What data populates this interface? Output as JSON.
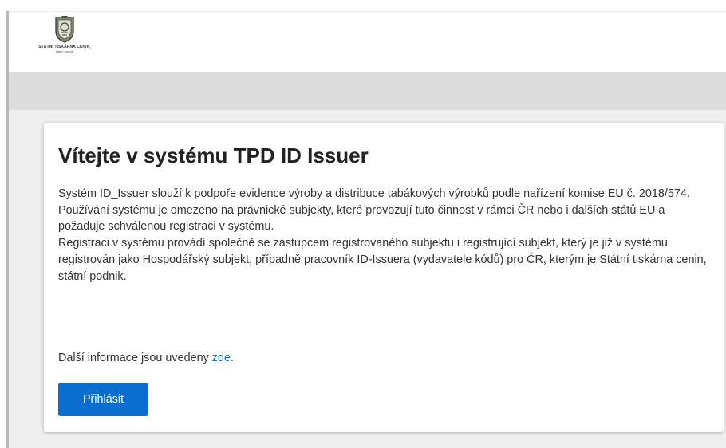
{
  "header": {
    "logo_icon": "state-emblem-icon",
    "logo_name": "STÁTNÍ TISKÁRNA CENIN,",
    "logo_subtitle": "státní podnik"
  },
  "card": {
    "title": "Vítejte v systému TPD ID Issuer",
    "paragraphs": [
      "Systém ID_Issuer slouží k podpoře evidence výroby a distribuce tabákových výrobků podle nařízení komise EU č. 2018/574.",
      "Používání systému je omezeno na právnické subjekty, které provozují tuto činnost v rámci ČR nebo i dalších států EU a požaduje schválenou registraci v systému.",
      "Registraci v systému provádí společně se zástupcem registrovaného subjektu i registrující subjekt, který je již v systému registrován jako Hospodářský subjekt, případně pracovník ID-Issuera (vydavatele kódů) pro ČR, kterým je Státní tiskárna cenin, státní podnik."
    ],
    "more_info_text": "Další informace jsou uvedeny ",
    "more_info_link": "zde",
    "more_info_suffix": ".",
    "login_label": "Přihlásit"
  },
  "colors": {
    "primary_button": "#0a6ed1",
    "link": "#1a73c8",
    "toolbar": "#dcdcdc",
    "content_background": "#eeeeee"
  }
}
